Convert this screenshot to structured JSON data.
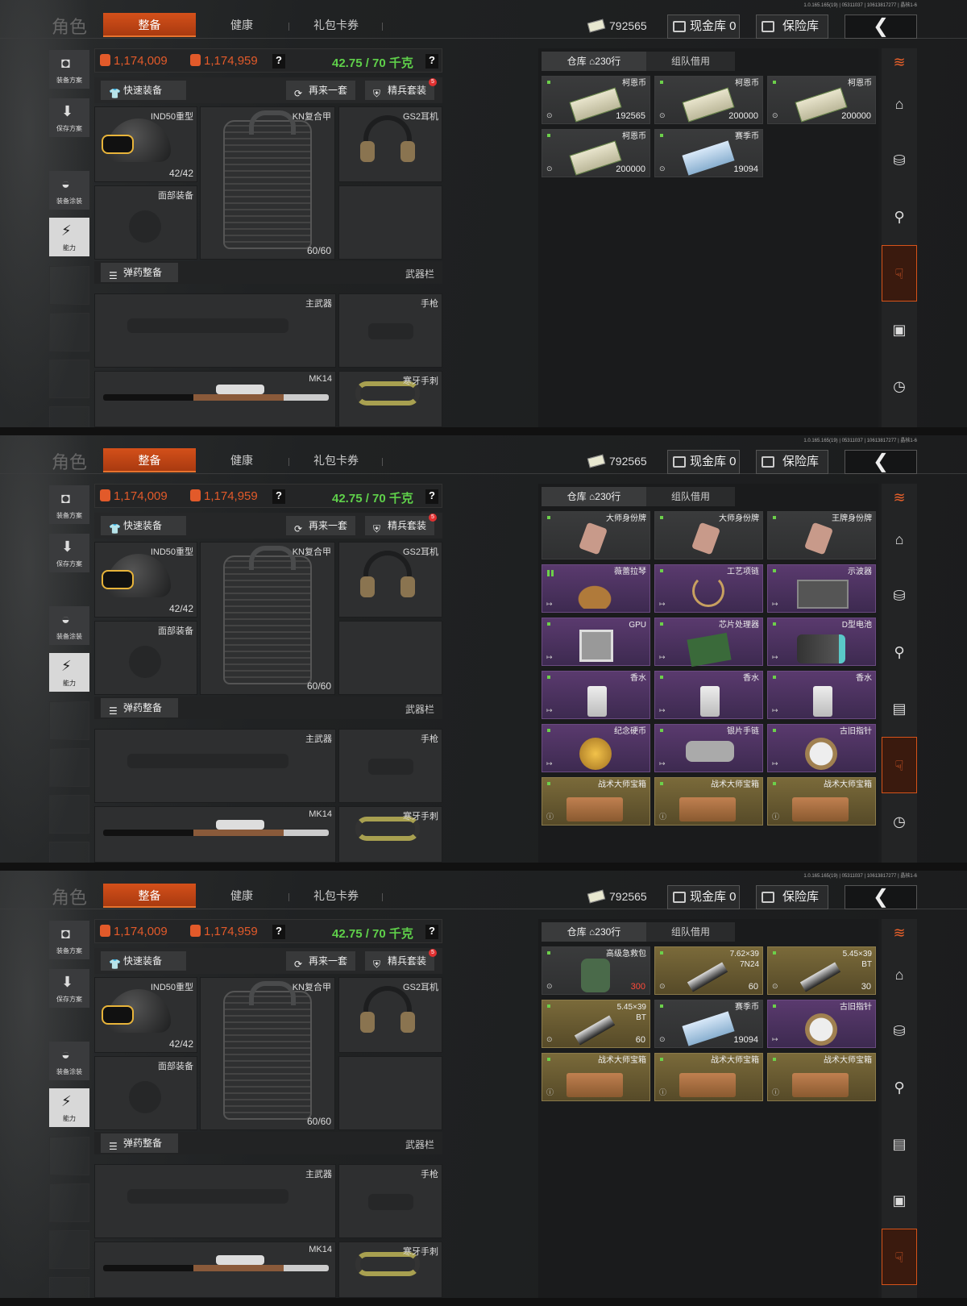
{
  "version": "1.0.165.165(19) | 05311037 | 10613817277 | 晶核1-6",
  "header": {
    "title": "角色",
    "tabs": [
      "整备",
      "健康",
      "礼包卡券"
    ],
    "money": "792565",
    "cash_vault": "现金库 0",
    "safe": "保险库",
    "back": "❮"
  },
  "sidebar": [
    {
      "label": "装备方案",
      "icon": "vest-icon"
    },
    {
      "label": "保存方案",
      "icon": "download-icon"
    },
    {
      "label": "装备涂装",
      "icon": "paint-icon"
    },
    {
      "label": "能力",
      "icon": "ability-icon"
    }
  ],
  "stats": {
    "value1": "1,174,009",
    "value2": "1,174,959",
    "weight": "42.75 / 70 千克",
    "q": "?"
  },
  "actions": {
    "quick": "快速装备",
    "again": "再来一套",
    "elite": "精兵套装",
    "elite_badge": "5"
  },
  "gear": {
    "helmet": "IND50重型",
    "helmet_count": "42/42",
    "armor": "KN复合甲",
    "armor_count": "60/60",
    "headset": "GS2耳机",
    "face": "面部装备",
    "ammo_btn": "弹药整备",
    "weapon_bar": "武器栏",
    "primary": "主武器",
    "pistol": "手枪",
    "mk14": "MK14",
    "melee": "寒牙手刺"
  },
  "warehouse": {
    "tab_main": "仓库",
    "tab_rows": "230行",
    "tab_team": "组队借用"
  },
  "panels": [
    {
      "items": [
        {
          "name": "柯恩币",
          "count": "192565",
          "style": "grey",
          "art": "cash"
        },
        {
          "name": "柯恩币",
          "count": "200000",
          "style": "grey",
          "art": "cash"
        },
        {
          "name": "柯恩币",
          "count": "200000",
          "style": "grey",
          "art": "cash"
        },
        {
          "name": "柯恩币",
          "count": "200000",
          "style": "grey",
          "art": "cash"
        },
        {
          "name": "赛季币",
          "count": "19094",
          "style": "grey",
          "art": "bluecash"
        }
      ]
    },
    {
      "items": [
        {
          "name": "大师身份牌",
          "count": "",
          "style": "grey",
          "art": "tag"
        },
        {
          "name": "大师身份牌",
          "count": "",
          "style": "grey",
          "art": "tag"
        },
        {
          "name": "王牌身份牌",
          "count": "",
          "style": "grey",
          "art": "tag"
        },
        {
          "name": "薇蕾拉琴",
          "count": "",
          "style": "purple",
          "art": "guitar"
        },
        {
          "name": "工艺项链",
          "count": "",
          "style": "purple",
          "art": "neck"
        },
        {
          "name": "示波器",
          "count": "",
          "style": "purple",
          "art": "osc"
        },
        {
          "name": "GPU",
          "count": "",
          "style": "purple",
          "art": "gpu"
        },
        {
          "name": "芯片处理器",
          "count": "",
          "style": "purple",
          "art": "chip"
        },
        {
          "name": "D型电池",
          "count": "",
          "style": "purple",
          "art": "batt"
        },
        {
          "name": "香水",
          "count": "",
          "style": "purple",
          "art": "perf"
        },
        {
          "name": "香水",
          "count": "",
          "style": "purple",
          "art": "perf"
        },
        {
          "name": "香水",
          "count": "",
          "style": "purple",
          "art": "perf"
        },
        {
          "name": "纪念硬币",
          "count": "",
          "style": "purple",
          "art": "coin"
        },
        {
          "name": "银片手链",
          "count": "",
          "style": "purple",
          "art": "brace"
        },
        {
          "name": "古旧指针",
          "count": "",
          "style": "purple",
          "art": "watch"
        },
        {
          "name": "战术大师宝箱",
          "count": "",
          "style": "gold",
          "art": "box"
        },
        {
          "name": "战术大师宝箱",
          "count": "",
          "style": "gold",
          "art": "box"
        },
        {
          "name": "战术大师宝箱",
          "count": "",
          "style": "gold",
          "art": "box"
        }
      ]
    },
    {
      "items": [
        {
          "name": "高级急救包",
          "count": "300",
          "style": "grey",
          "art": "med",
          "red": true
        },
        {
          "name": "7.62×39",
          "sub": "7N24",
          "count": "60",
          "style": "gold",
          "art": "ammo"
        },
        {
          "name": "5.45×39",
          "sub": "BT",
          "count": "30",
          "style": "gold",
          "art": "ammo"
        },
        {
          "name": "5.45×39",
          "sub": "BT",
          "count": "60",
          "style": "gold",
          "art": "ammo"
        },
        {
          "name": "赛季币",
          "count": "19094",
          "style": "grey",
          "art": "bluecash"
        },
        {
          "name": "古旧指针",
          "count": "",
          "style": "purple",
          "art": "watch"
        },
        {
          "name": "战术大师宝箱",
          "count": "",
          "style": "gold",
          "art": "box"
        },
        {
          "name": "战术大师宝箱",
          "count": "",
          "style": "gold",
          "art": "box"
        },
        {
          "name": "战术大师宝箱",
          "count": "",
          "style": "gold",
          "art": "box"
        }
      ]
    }
  ],
  "right_icons": [
    [
      "layers-icon",
      "home-icon",
      "stack-icon",
      "wrench-icon",
      "hand-icon",
      "box-icon",
      "clock-icon"
    ],
    [
      "layers-icon",
      "home-icon",
      "stack-icon",
      "wrench-icon",
      "cash-icon",
      "hand-icon",
      "clock-icon"
    ],
    [
      "layers-icon",
      "home-icon",
      "stack-icon",
      "wrench-icon",
      "cash-icon",
      "box-icon",
      "hand-icon"
    ]
  ],
  "active_right": [
    4,
    5,
    6
  ]
}
